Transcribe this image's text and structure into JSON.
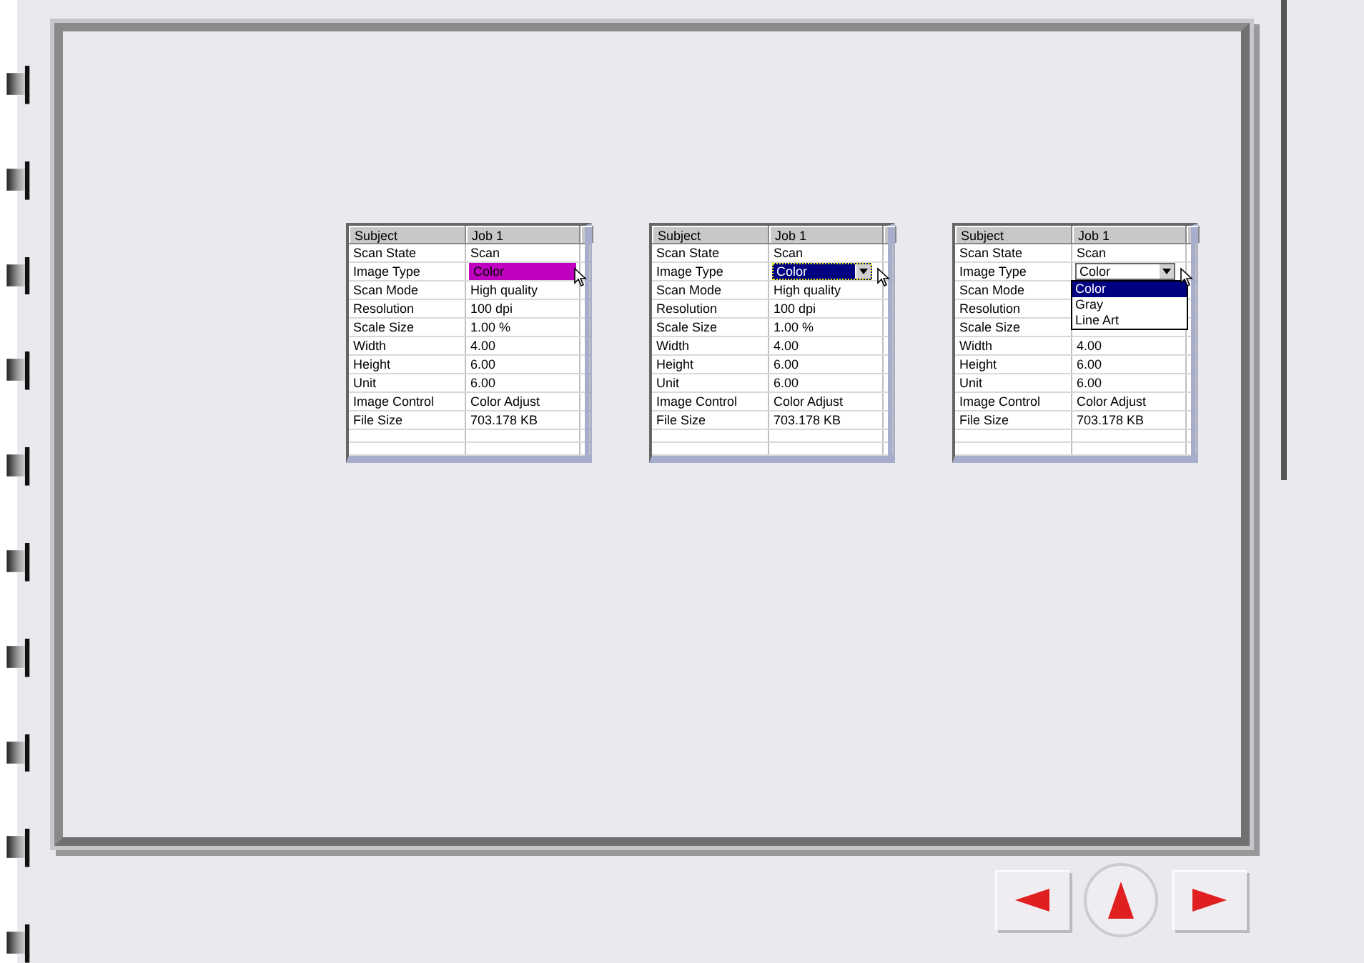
{
  "panels": [
    {
      "columns": [
        "Subject",
        "Job 1"
      ],
      "rows": [
        {
          "label": "Scan State",
          "value": "Scan"
        },
        {
          "label": "Image Type",
          "value": "Color",
          "kind": "highlight"
        },
        {
          "label": "Scan Mode",
          "value": "High quality"
        },
        {
          "label": "Resolution",
          "value": "100 dpi"
        },
        {
          "label": "Scale Size",
          "value": "1.00 %"
        },
        {
          "label": "Width",
          "value": "4.00"
        },
        {
          "label": "Height",
          "value": "6.00"
        },
        {
          "label": "Unit",
          "value": "6.00"
        },
        {
          "label": "Image Control",
          "value": "Color Adjust"
        },
        {
          "label": "File Size",
          "value": "703.178 KB"
        }
      ]
    },
    {
      "columns": [
        "Subject",
        "Job 1"
      ],
      "rows": [
        {
          "label": "Scan State",
          "value": "Scan"
        },
        {
          "label": "Image Type",
          "value": "Color",
          "kind": "combo"
        },
        {
          "label": "Scan Mode",
          "value": "High quality"
        },
        {
          "label": "Resolution",
          "value": "100 dpi"
        },
        {
          "label": "Scale Size",
          "value": "1.00 %"
        },
        {
          "label": "Width",
          "value": "4.00"
        },
        {
          "label": "Height",
          "value": "6.00"
        },
        {
          "label": "Unit",
          "value": "6.00"
        },
        {
          "label": "Image Control",
          "value": "Color Adjust"
        },
        {
          "label": "File Size",
          "value": "703.178 KB"
        }
      ]
    },
    {
      "columns": [
        "Subject",
        "Job 1"
      ],
      "rows": [
        {
          "label": "Scan State",
          "value": "Scan"
        },
        {
          "label": "Image Type",
          "value": "Color",
          "kind": "open-combo",
          "options": [
            {
              "label": "Color",
              "selected": true
            },
            {
              "label": "Gray",
              "selected": false
            },
            {
              "label": "Line Art",
              "selected": false
            }
          ]
        },
        {
          "label": "Scan Mode"
        },
        {
          "label": "Resolution"
        },
        {
          "label": "Scale Size"
        },
        {
          "label": "Width",
          "value": "4.00"
        },
        {
          "label": "Height",
          "value": "6.00"
        },
        {
          "label": "Unit",
          "value": "6.00"
        },
        {
          "label": "Image Control",
          "value": "Color Adjust"
        },
        {
          "label": "File Size",
          "value": "703.178 KB"
        }
      ]
    }
  ]
}
